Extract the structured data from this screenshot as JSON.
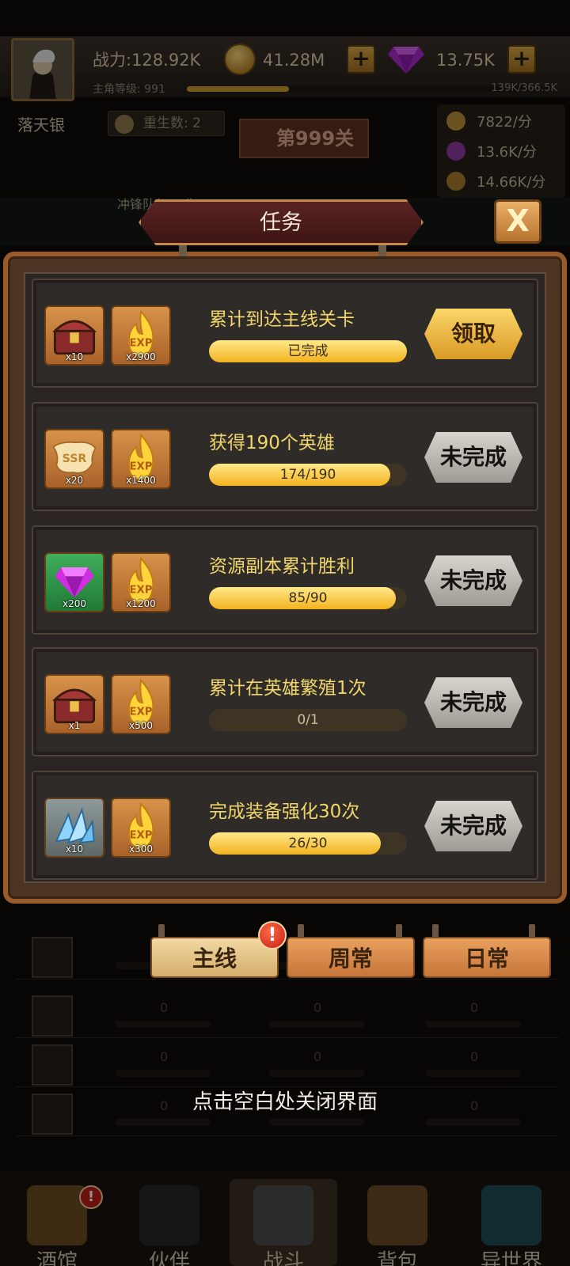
{
  "header": {
    "power": "战力:128.92K",
    "level": "主角等级: 991",
    "gold": "41.28M",
    "gems": "13.75K",
    "exp": "139K/366.5K"
  },
  "hero": {
    "name": "落天银",
    "rebirth": "重生数: 2",
    "stage": "第999关",
    "scene_text": "冲锋队伍… 生"
  },
  "rates": [
    "7822/分",
    "13.6K/分",
    "14.66K/分"
  ],
  "modal": {
    "title": "任务",
    "close_symbol": "X",
    "tasks": [
      {
        "title": "累计到达主线关卡",
        "progress_text": "已完成",
        "progress": 1.0,
        "action": "领取",
        "action_type": "claim",
        "rewards": [
          {
            "icon": "treasure-chest-icon",
            "qty": "x10"
          },
          {
            "icon": "exp-flame-icon",
            "qty": "x2900"
          }
        ]
      },
      {
        "title": "获得190个英雄",
        "progress_text": "174/190",
        "progress": 0.916,
        "action": "未完成",
        "action_type": "pending",
        "rewards": [
          {
            "icon": "ssr-scroll-icon",
            "qty": "x20"
          },
          {
            "icon": "exp-flame-icon",
            "qty": "x1400"
          }
        ]
      },
      {
        "title": "资源副本累计胜利",
        "progress_text": "85/90",
        "progress": 0.944,
        "action": "未完成",
        "action_type": "pending",
        "rewards": [
          {
            "icon": "purple-gem-icon",
            "qty": "x200"
          },
          {
            "icon": "exp-flame-icon",
            "qty": "x1200"
          }
        ]
      },
      {
        "title": "累计在英雄繁殖1次",
        "progress_text": "0/1",
        "progress": 0.0,
        "action": "未完成",
        "action_type": "pending",
        "rewards": [
          {
            "icon": "treasure-chest-icon",
            "qty": "x1"
          },
          {
            "icon": "exp-flame-icon",
            "qty": "x500"
          }
        ]
      },
      {
        "title": "完成装备强化30次",
        "progress_text": "26/30",
        "progress": 0.867,
        "action": "未完成",
        "action_type": "pending",
        "rewards": [
          {
            "icon": "crystal-shard-icon",
            "qty": "x10"
          },
          {
            "icon": "exp-flame-icon",
            "qty": "x300"
          }
        ]
      }
    ]
  },
  "tabs": [
    "主线",
    "周常",
    "日常"
  ],
  "tab_alert": "!",
  "list_zero": "0",
  "close_hint": "点击空白处关闭界面",
  "bottom_nav": [
    "酒馆",
    "伙伴",
    "战斗",
    "背包",
    "异世界"
  ],
  "nav_alert": "!",
  "colors": {
    "accent_gold": "#f0d66b",
    "frame_brown": "#9a5b2b",
    "claim_button": "#fbd66a",
    "pending_button": "#c9c5be"
  }
}
